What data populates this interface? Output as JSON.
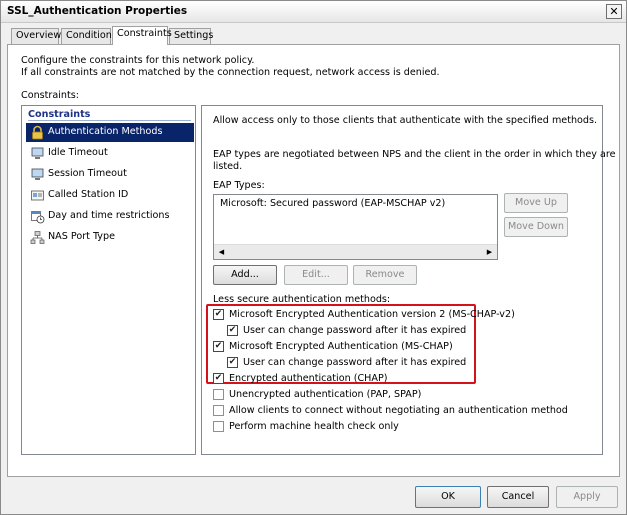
{
  "window": {
    "title": "SSL_Authentication Properties",
    "close_glyph": "✕"
  },
  "tabs": [
    {
      "label": "Overview"
    },
    {
      "label": "Conditions"
    },
    {
      "label": "Constraints"
    },
    {
      "label": "Settings"
    }
  ],
  "intro": {
    "line1": "Configure the constraints for this network policy.",
    "line2": "If all constraints are not matched by the connection request, network access is denied."
  },
  "constraints_label": "Constraints:",
  "nav": {
    "header": "Constraints",
    "items": [
      {
        "label": "Authentication Methods",
        "icon": "lock-icon"
      },
      {
        "label": "Idle Timeout",
        "icon": "computer-icon"
      },
      {
        "label": "Session Timeout",
        "icon": "computer-icon"
      },
      {
        "label": "Called Station ID",
        "icon": "card-icon"
      },
      {
        "label": "Day and time restrictions",
        "icon": "calendar-clock-icon"
      },
      {
        "label": "NAS Port Type",
        "icon": "network-icon"
      }
    ]
  },
  "panel": {
    "description": "Allow access only to those clients that authenticate with the specified methods.",
    "eap_note_line1": "EAP types are negotiated between NPS and the client in the order in which they are",
    "eap_note_line2": "listed.",
    "eap_types_label": "EAP Types:",
    "eap_types": [
      "Microsoft: Secured password (EAP-MSCHAP v2)"
    ],
    "move_up": "Move Up",
    "move_down": "Move Down",
    "add": "Add...",
    "edit": "Edit...",
    "remove": "Remove",
    "less_secure_label": "Less secure authentication methods:",
    "methods": [
      {
        "label": "Microsoft Encrypted Authentication version 2 (MS-CHAP-v2)",
        "checked": true
      },
      {
        "label": "User can change password after it has expired",
        "checked": true
      },
      {
        "label": "Microsoft Encrypted Authentication (MS-CHAP)",
        "checked": true
      },
      {
        "label": "User can change password after it has expired",
        "checked": true
      },
      {
        "label": "Encrypted authentication (CHAP)",
        "checked": true
      },
      {
        "label": "Unencrypted authentication (PAP, SPAP)",
        "checked": false
      },
      {
        "label": "Allow clients to connect without negotiating an authentication method",
        "checked": false
      },
      {
        "label": "Perform machine health check only",
        "checked": false
      }
    ],
    "check_glyph": "✔",
    "highlight_color": "#d4121a"
  },
  "footer": {
    "ok": "OK",
    "cancel": "Cancel",
    "apply": "Apply"
  },
  "colors": {
    "selection": "#0a246a",
    "header_text": "#1e3287"
  }
}
